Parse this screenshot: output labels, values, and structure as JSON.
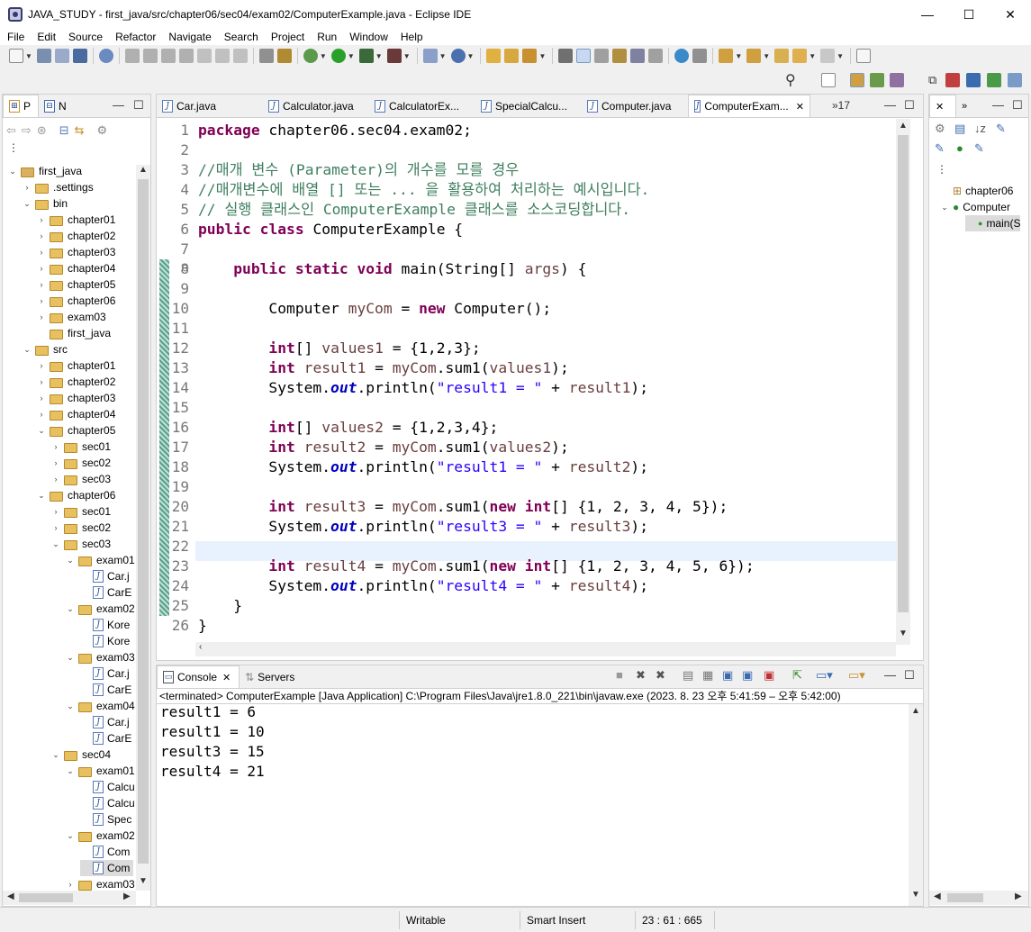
{
  "window": {
    "title": "JAVA_STUDY - first_java/src/chapter06/sec04/exam02/ComputerExample.java - Eclipse IDE",
    "minimize": "—",
    "maximize": "☐",
    "close": "✕"
  },
  "menu": [
    "File",
    "Edit",
    "Source",
    "Refactor",
    "Navigate",
    "Search",
    "Project",
    "Run",
    "Window",
    "Help"
  ],
  "left_panel": {
    "tabs": [
      "P",
      "N"
    ]
  },
  "tree": [
    {
      "label": "first_java",
      "indent": 0,
      "chev": "v",
      "icon": "project"
    },
    {
      "label": ".settings",
      "indent": 1,
      "chev": ">",
      "icon": "folder"
    },
    {
      "label": "bin",
      "indent": 1,
      "chev": "v",
      "icon": "folder"
    },
    {
      "label": "chapter01",
      "indent": 2,
      "chev": ">",
      "icon": "folder"
    },
    {
      "label": "chapter02",
      "indent": 2,
      "chev": ">",
      "icon": "folder"
    },
    {
      "label": "chapter03",
      "indent": 2,
      "chev": ">",
      "icon": "folder"
    },
    {
      "label": "chapter04",
      "indent": 2,
      "chev": ">",
      "icon": "folder"
    },
    {
      "label": "chapter05",
      "indent": 2,
      "chev": ">",
      "icon": "folder"
    },
    {
      "label": "chapter06",
      "indent": 2,
      "chev": ">",
      "icon": "folder"
    },
    {
      "label": "exam03",
      "indent": 2,
      "chev": ">",
      "icon": "folder"
    },
    {
      "label": "first_java",
      "indent": 2,
      "chev": "",
      "icon": "folder"
    },
    {
      "label": "src",
      "indent": 1,
      "chev": "v",
      "icon": "folder"
    },
    {
      "label": "chapter01",
      "indent": 2,
      "chev": ">",
      "icon": "folder"
    },
    {
      "label": "chapter02",
      "indent": 2,
      "chev": ">",
      "icon": "folder"
    },
    {
      "label": "chapter03",
      "indent": 2,
      "chev": ">",
      "icon": "folder"
    },
    {
      "label": "chapter04",
      "indent": 2,
      "chev": ">",
      "icon": "folder"
    },
    {
      "label": "chapter05",
      "indent": 2,
      "chev": "v",
      "icon": "folder"
    },
    {
      "label": "sec01",
      "indent": 3,
      "chev": ">",
      "icon": "folder"
    },
    {
      "label": "sec02",
      "indent": 3,
      "chev": ">",
      "icon": "folder"
    },
    {
      "label": "sec03",
      "indent": 3,
      "chev": ">",
      "icon": "folder"
    },
    {
      "label": "chapter06",
      "indent": 2,
      "chev": "v",
      "icon": "folder"
    },
    {
      "label": "sec01",
      "indent": 3,
      "chev": ">",
      "icon": "folder"
    },
    {
      "label": "sec02",
      "indent": 3,
      "chev": ">",
      "icon": "folder"
    },
    {
      "label": "sec03",
      "indent": 3,
      "chev": "v",
      "icon": "folder"
    },
    {
      "label": "exam01",
      "indent": 4,
      "chev": "v",
      "icon": "folder"
    },
    {
      "label": "Car.j",
      "indent": 5,
      "chev": "",
      "icon": "java"
    },
    {
      "label": "CarE",
      "indent": 5,
      "chev": "",
      "icon": "java"
    },
    {
      "label": "exam02",
      "indent": 4,
      "chev": "v",
      "icon": "folder"
    },
    {
      "label": "Kore",
      "indent": 5,
      "chev": "",
      "icon": "java"
    },
    {
      "label": "Kore",
      "indent": 5,
      "chev": "",
      "icon": "java"
    },
    {
      "label": "exam03",
      "indent": 4,
      "chev": "v",
      "icon": "folder"
    },
    {
      "label": "Car.j",
      "indent": 5,
      "chev": "",
      "icon": "java"
    },
    {
      "label": "CarE",
      "indent": 5,
      "chev": "",
      "icon": "java"
    },
    {
      "label": "exam04",
      "indent": 4,
      "chev": "v",
      "icon": "folder"
    },
    {
      "label": "Car.j",
      "indent": 5,
      "chev": "",
      "icon": "java"
    },
    {
      "label": "CarE",
      "indent": 5,
      "chev": "",
      "icon": "java"
    },
    {
      "label": "sec04",
      "indent": 3,
      "chev": "v",
      "icon": "folder"
    },
    {
      "label": "exam01",
      "indent": 4,
      "chev": "v",
      "icon": "folder"
    },
    {
      "label": "Calcu",
      "indent": 5,
      "chev": "",
      "icon": "java"
    },
    {
      "label": "Calcu",
      "indent": 5,
      "chev": "",
      "icon": "java"
    },
    {
      "label": "Spec",
      "indent": 5,
      "chev": "",
      "icon": "java"
    },
    {
      "label": "exam02",
      "indent": 4,
      "chev": "v",
      "icon": "folder"
    },
    {
      "label": "Com",
      "indent": 5,
      "chev": "",
      "icon": "java"
    },
    {
      "label": "Com",
      "indent": 5,
      "chev": "",
      "icon": "java",
      "selected": true
    },
    {
      "label": "exam03",
      "indent": 4,
      "chev": ">",
      "icon": "folder"
    }
  ],
  "editor": {
    "tabs": [
      "Car.java",
      "Calculator.java",
      "CalculatorEx...",
      "SpecialCalcu...",
      "Computer.java",
      "ComputerExam..."
    ],
    "active_tab": 5,
    "overflow": "»17",
    "tab_close": "✕",
    "fold_marker": "⊖",
    "line_numbers": [
      "1",
      "2",
      "3",
      "4",
      "5",
      "6",
      "7",
      "8",
      "9",
      "10",
      "11",
      "12",
      "13",
      "14",
      "15",
      "16",
      "17",
      "18",
      "19",
      "20",
      "21",
      "22",
      "23",
      "24",
      "25",
      "26"
    ],
    "lines": [
      [
        {
          "t": "package",
          "c": "kw"
        },
        {
          "t": " chapter06.sec04.exam02;"
        }
      ],
      [],
      [
        {
          "t": "//매개 변수 (Parameter)의 개수를 모를 경우",
          "c": "cm"
        }
      ],
      [
        {
          "t": "//매개변수에 배열 [] 또는 ... 을 활용하여 처리하는 예시입니다.",
          "c": "cm"
        }
      ],
      [
        {
          "t": "// 실행 클래스인 ComputerExample 클래스를 소스코딩합니다.",
          "c": "cm"
        }
      ],
      [
        {
          "t": "public",
          "c": "kw"
        },
        {
          "t": " "
        },
        {
          "t": "class",
          "c": "kw"
        },
        {
          "t": " ComputerExample {"
        }
      ],
      [],
      [
        {
          "t": "    "
        },
        {
          "t": "public",
          "c": "kw"
        },
        {
          "t": " "
        },
        {
          "t": "static",
          "c": "kw"
        },
        {
          "t": " "
        },
        {
          "t": "void",
          "c": "kw"
        },
        {
          "t": " main(String[] "
        },
        {
          "t": "args",
          "c": "var"
        },
        {
          "t": ") {"
        }
      ],
      [],
      [
        {
          "t": "        Computer "
        },
        {
          "t": "myCom",
          "c": "var"
        },
        {
          "t": " = "
        },
        {
          "t": "new",
          "c": "kw"
        },
        {
          "t": " Computer();"
        }
      ],
      [],
      [
        {
          "t": "        "
        },
        {
          "t": "int",
          "c": "kw"
        },
        {
          "t": "[] "
        },
        {
          "t": "values1",
          "c": "var"
        },
        {
          "t": " = {1,2,3};"
        }
      ],
      [
        {
          "t": "        "
        },
        {
          "t": "int",
          "c": "kw"
        },
        {
          "t": " "
        },
        {
          "t": "result1",
          "c": "var"
        },
        {
          "t": " = "
        },
        {
          "t": "myCom",
          "c": "var"
        },
        {
          "t": ".sum1("
        },
        {
          "t": "values1",
          "c": "var"
        },
        {
          "t": ");"
        }
      ],
      [
        {
          "t": "        System."
        },
        {
          "t": "out",
          "c": "fld"
        },
        {
          "t": ".println("
        },
        {
          "t": "\"result1 = \"",
          "c": "st"
        },
        {
          "t": " + "
        },
        {
          "t": "result1",
          "c": "var"
        },
        {
          "t": ");"
        }
      ],
      [],
      [
        {
          "t": "        "
        },
        {
          "t": "int",
          "c": "kw"
        },
        {
          "t": "[] "
        },
        {
          "t": "values2",
          "c": "var"
        },
        {
          "t": " = {1,2,3,4};"
        }
      ],
      [
        {
          "t": "        "
        },
        {
          "t": "int",
          "c": "kw"
        },
        {
          "t": " "
        },
        {
          "t": "result2",
          "c": "var"
        },
        {
          "t": " = "
        },
        {
          "t": "myCom",
          "c": "var"
        },
        {
          "t": ".sum1("
        },
        {
          "t": "values2",
          "c": "var"
        },
        {
          "t": ");"
        }
      ],
      [
        {
          "t": "        System."
        },
        {
          "t": "out",
          "c": "fld"
        },
        {
          "t": ".println("
        },
        {
          "t": "\"result1 = \"",
          "c": "st"
        },
        {
          "t": " + "
        },
        {
          "t": "result2",
          "c": "var"
        },
        {
          "t": ");"
        }
      ],
      [],
      [
        {
          "t": "        "
        },
        {
          "t": "int",
          "c": "kw"
        },
        {
          "t": " "
        },
        {
          "t": "result3",
          "c": "var"
        },
        {
          "t": " = "
        },
        {
          "t": "myCom",
          "c": "var"
        },
        {
          "t": ".sum1("
        },
        {
          "t": "new",
          "c": "kw"
        },
        {
          "t": " "
        },
        {
          "t": "int",
          "c": "kw"
        },
        {
          "t": "[] {1, 2, 3, 4, 5});"
        }
      ],
      [
        {
          "t": "        System."
        },
        {
          "t": "out",
          "c": "fld"
        },
        {
          "t": ".println("
        },
        {
          "t": "\"result3 = \"",
          "c": "st"
        },
        {
          "t": " + "
        },
        {
          "t": "result3",
          "c": "var"
        },
        {
          "t": ");"
        }
      ],
      [],
      [
        {
          "t": "        "
        },
        {
          "t": "int",
          "c": "kw"
        },
        {
          "t": " "
        },
        {
          "t": "result4",
          "c": "var"
        },
        {
          "t": " = "
        },
        {
          "t": "myCom",
          "c": "var"
        },
        {
          "t": ".sum1("
        },
        {
          "t": "new",
          "c": "kw"
        },
        {
          "t": " "
        },
        {
          "t": "int",
          "c": "kw"
        },
        {
          "t": "[] {1, 2, 3, 4, 5, 6});"
        }
      ],
      [
        {
          "t": "        System."
        },
        {
          "t": "out",
          "c": "fld"
        },
        {
          "t": ".println("
        },
        {
          "t": "\"result4 = \"",
          "c": "st"
        },
        {
          "t": " + "
        },
        {
          "t": "result4",
          "c": "var"
        },
        {
          "t": ");"
        }
      ],
      [
        {
          "t": "    }"
        }
      ],
      [
        {
          "t": "}"
        }
      ]
    ],
    "current_line": 23
  },
  "console": {
    "tabs": [
      "Console",
      "Servers"
    ],
    "status": "<terminated> ComputerExample [Java Application] C:\\Program Files\\Java\\jre1.8.0_221\\bin\\javaw.exe  (2023. 8. 23 오후 5:41:59 – 오후 5:42:00)",
    "output": [
      "result1 = 6",
      "result1 = 10",
      "result3 = 15",
      "result4 = 21"
    ]
  },
  "outline": {
    "items": [
      {
        "label": "chapter06",
        "indent": 0,
        "chev": ""
      },
      {
        "label": "Computer",
        "indent": 0,
        "chev": "v"
      },
      {
        "label": "main(S",
        "indent": 1,
        "chev": ""
      }
    ]
  },
  "status": {
    "writable": "Writable",
    "insert": "Smart Insert",
    "position": "23 : 61 : 665"
  },
  "colors": {
    "keyword": "#7f0055",
    "comment": "#3f7f5f",
    "string": "#2a00ff",
    "field": "#0000c0",
    "current_line": "#e8f2fe"
  }
}
